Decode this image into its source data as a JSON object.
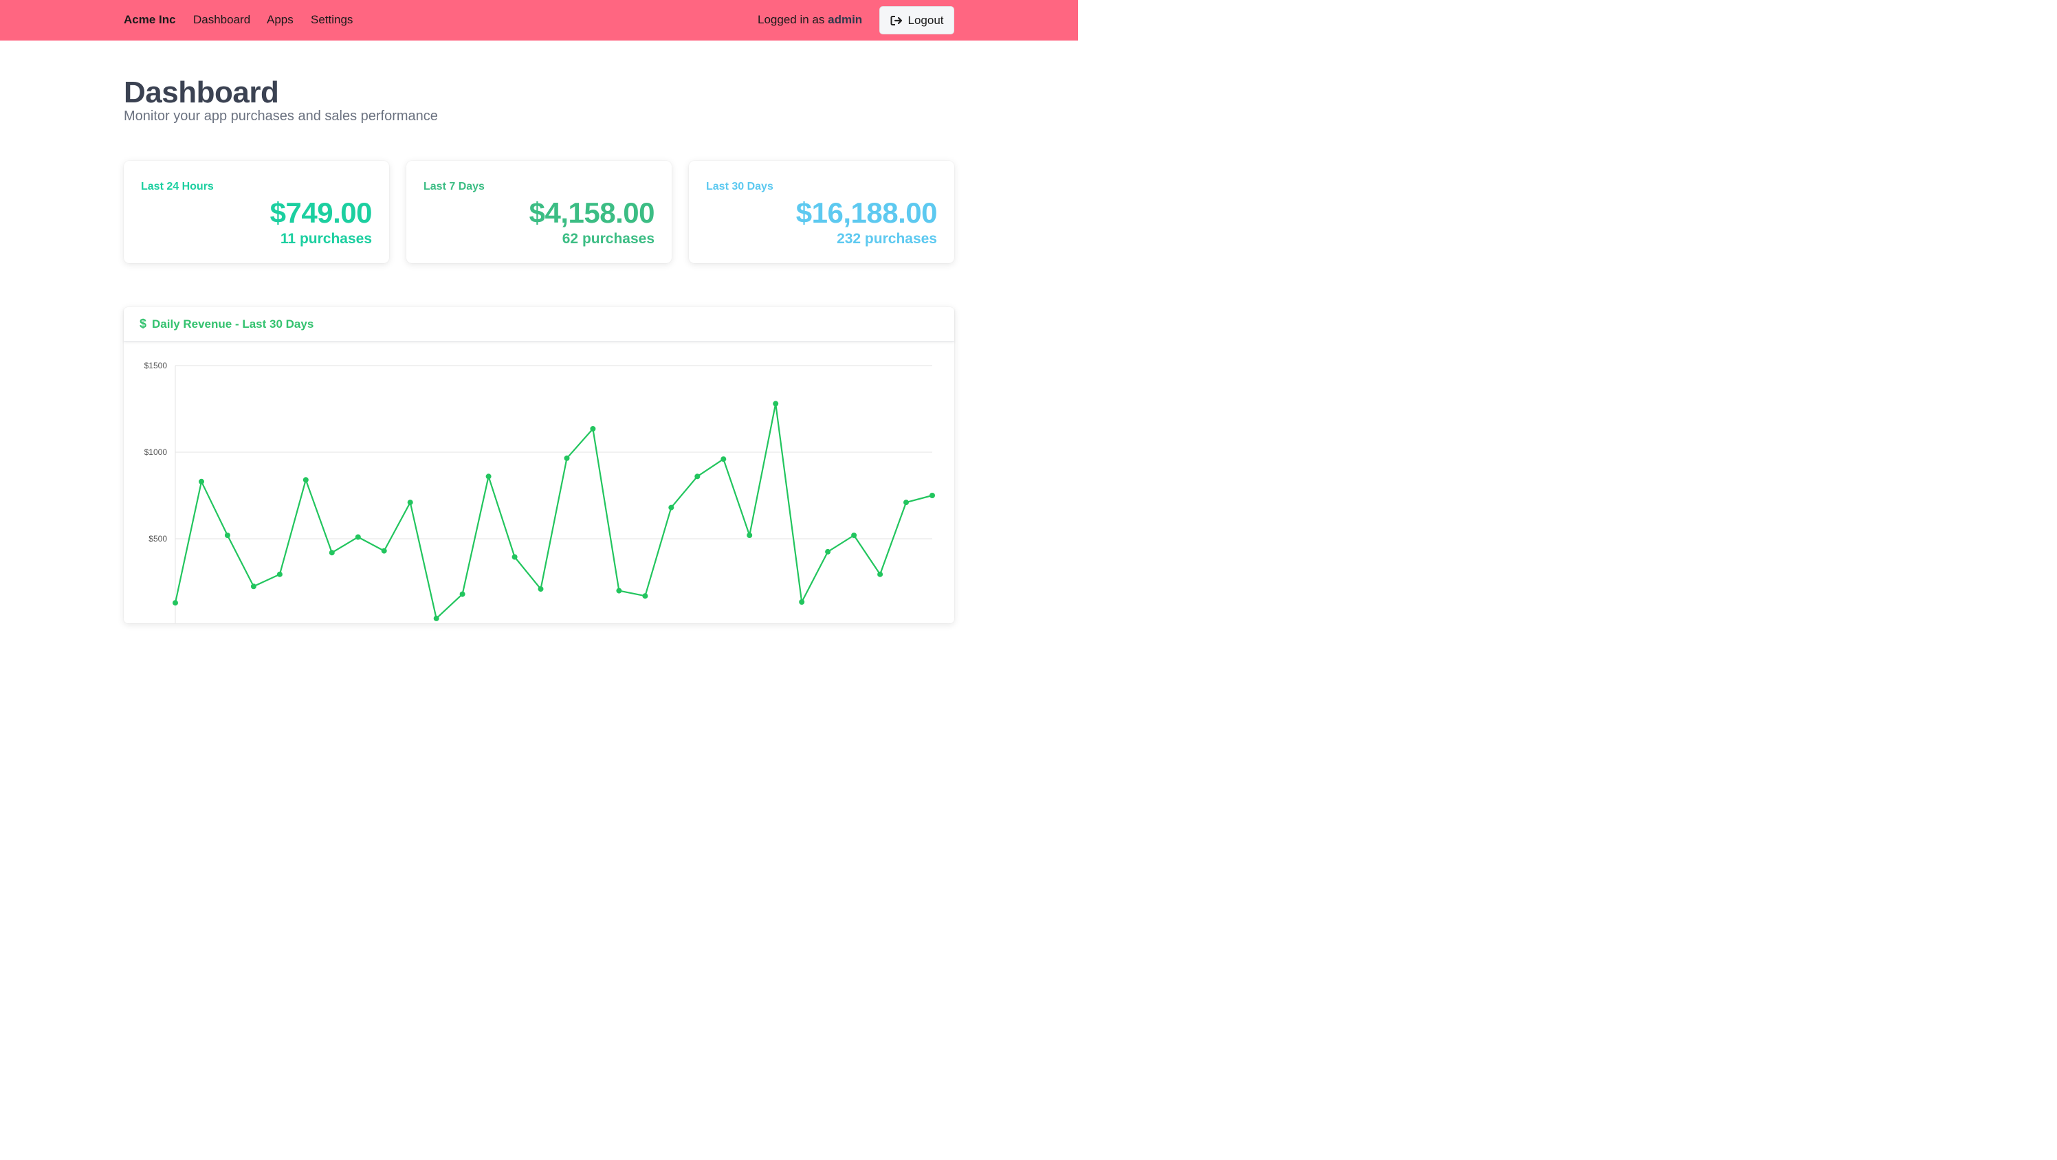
{
  "nav": {
    "brand": "Acme Inc",
    "links": [
      "Dashboard",
      "Apps",
      "Settings"
    ],
    "logged_in_prefix": "Logged in as",
    "username": "admin",
    "logout_label": "Logout",
    "bar_color": "#ff6681"
  },
  "header": {
    "title": "Dashboard",
    "subtitle": "Monitor your app purchases and sales performance"
  },
  "stats": [
    {
      "label": "Last 24 Hours",
      "amount": "$749.00",
      "count": "11 purchases",
      "color": "#1ccfa0"
    },
    {
      "label": "Last 7 Days",
      "amount": "$4,158.00",
      "count": "62 purchases",
      "color": "#3cbd84"
    },
    {
      "label": "Last 30 Days",
      "amount": "$16,188.00",
      "count": "232 purchases",
      "color": "#5dc9f0"
    }
  ],
  "chart": {
    "title": "Daily Revenue - Last 30 Days",
    "icon": "dollar-icon"
  },
  "chart_data": {
    "type": "line",
    "title": "Daily Revenue - Last 30 Days",
    "xlabel": "",
    "ylabel": "",
    "y_ticks": [
      "$1500",
      "$1000",
      "$500"
    ],
    "y_tick_values": [
      1500,
      1000,
      500
    ],
    "ylim": [
      0,
      1500
    ],
    "grid": true,
    "line_color": "#22c55e",
    "series": [
      {
        "values": [
          130,
          830,
          520,
          225,
          295,
          840,
          420,
          510,
          430,
          710,
          40,
          180,
          860,
          395,
          210,
          965,
          1135,
          200,
          170,
          680,
          860,
          960,
          520,
          1280,
          135,
          425,
          520,
          295,
          710,
          750
        ]
      }
    ]
  }
}
